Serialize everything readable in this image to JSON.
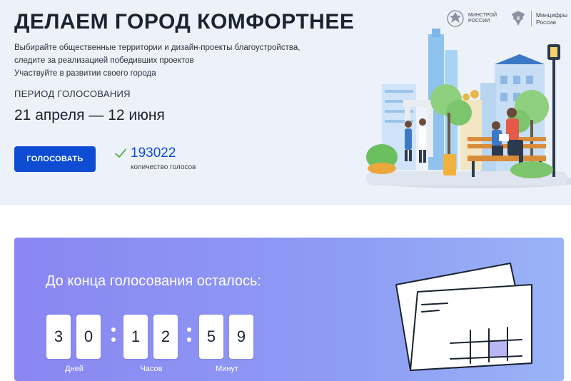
{
  "hero": {
    "title": "ДЕЛАЕМ ГОРОД КОМФОРТНЕЕ",
    "description": [
      "Выбирайте общественные территории и дизайн-проекты благоустройства,",
      "следите за реализацией победивших проектов",
      "Участвуйте в развитии своего города"
    ],
    "period_label": "ПЕРИОД ГОЛОСОВАНИЯ",
    "period_value": "21 апреля — 12 июня",
    "vote_button": "ГОЛОСОВАТЬ",
    "vote_count": "193022",
    "vote_count_label": "количество голосов"
  },
  "logos": {
    "minstroy": [
      "МИНСТРОЙ",
      "РОССИИ"
    ],
    "mincifry": [
      "Минцифры",
      "России"
    ]
  },
  "countdown": {
    "title": "До конца голосования осталось:",
    "days": [
      "3",
      "0"
    ],
    "hours": [
      "1",
      "2"
    ],
    "minutes": [
      "5",
      "9"
    ],
    "labels": {
      "days": "Дней",
      "hours": "Часов",
      "minutes": "Минут"
    }
  },
  "colors": {
    "accent": "#0d4cd3",
    "hero_bg": "#edf2fa",
    "card_bg": "#8b8bf3"
  }
}
